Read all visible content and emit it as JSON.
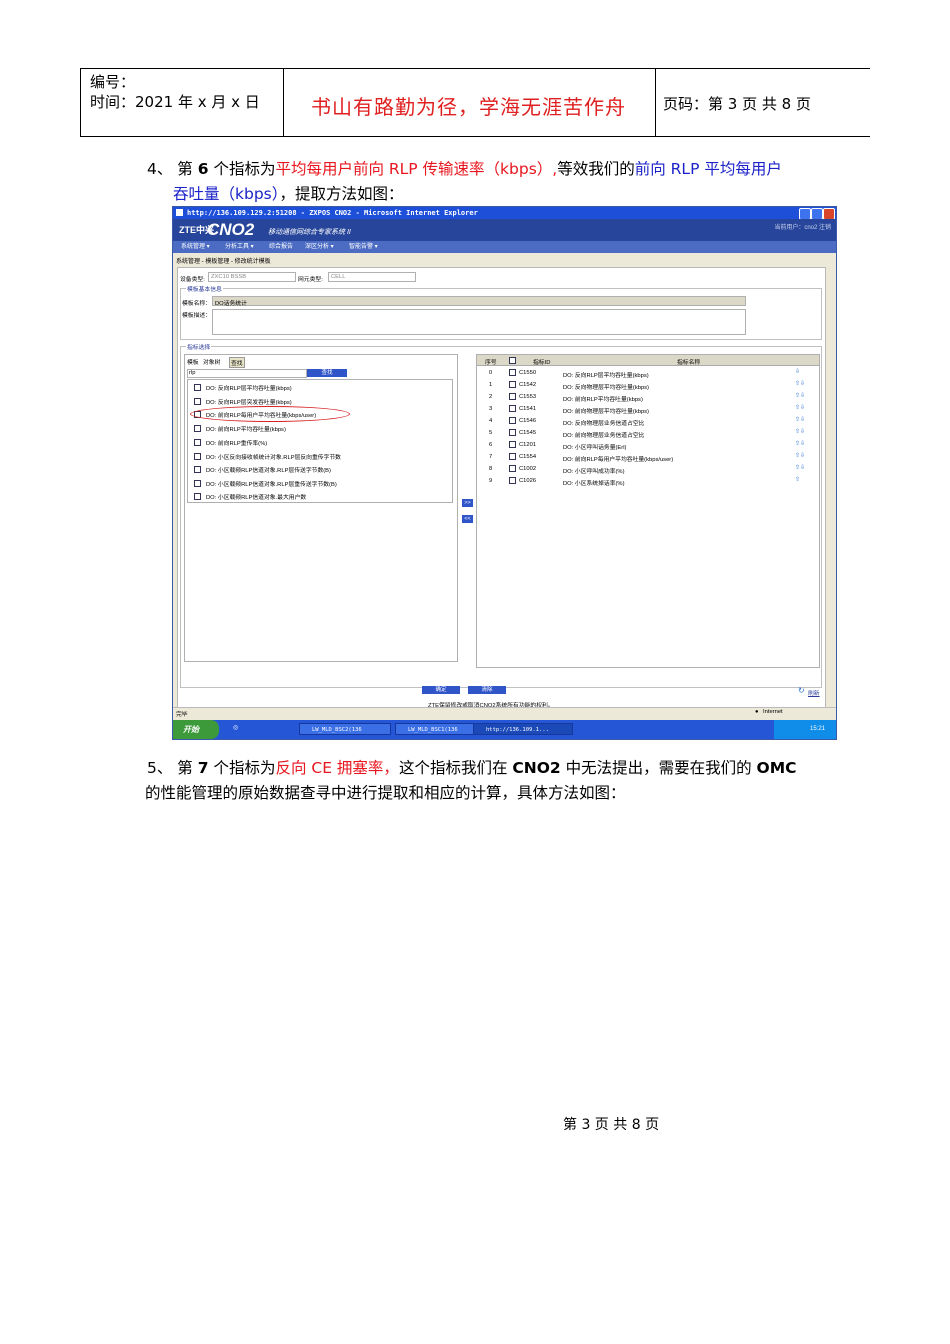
{
  "header": {
    "number_label": "编号：",
    "time_label": "时间：2021 年 x 月 x 日",
    "motto": "书山有路勤为径，学海无涯苦作舟",
    "page_label": "页码：第 3 页 共 8 页"
  },
  "para4": {
    "prefix": "4、 第 ",
    "num": "6",
    "mid": " 个指标为",
    "metric_red": "平均每用户前向 RLP 传输速率（kbps）,",
    "mid2": "等效我们的",
    "metric_blue_1": "前向 RLP 平均每用户",
    "metric_blue_2": "吞吐量（kbps）",
    "suffix": "，提取方法如图："
  },
  "screenshot": {
    "window_title": "http://136.109.129.2:51208 - ZXPOS CNO2 - Microsoft Internet Explorer",
    "logo": "ZTE中兴",
    "app_name": "CNO2",
    "app_subtitle": "移动通信网综合专家系统 II",
    "user_info": "当前用户：cno2  注销",
    "menu": [
      "系统管理 ▾",
      "分析工具 ▾",
      "综合报告",
      "深区分析 ▾",
      "智能告警 ▾"
    ],
    "breadcrumb": "系统管理 - 模板管理 - 修改统计模板",
    "device_type_label": "设备类型:",
    "device_type_value": "ZXC10 BSSB",
    "ne_type_label": "网元类型:",
    "ne_type_value": "CELL",
    "basic_info_legend": "模板基本信息",
    "template_name_label": "模板名称：",
    "template_name_value": "DO话务统计",
    "template_desc_label": "模板描述：",
    "indicator_legend": "指标选择",
    "tabs": [
      "模板",
      "对象树",
      "查找"
    ],
    "search_value": "rlp",
    "search_button": "查找",
    "left_items": [
      "DO: 反向RLP层平均吞吐量(kbps)",
      "DO: 反向RLP层突发吞吐量(kbps)",
      "DO: 前向RLP每用户平均吞吐量(kbps/user)",
      "DO: 前向RLP平均吞吐量(kbps)",
      "DO: 前向RLP重传率(%)",
      "DO: 小区反向接收帧统计对象.RLP层反向重传字节数",
      "DO: 小区载频RLP信道对象.RLP层传送字节数(B)",
      "DO: 小区载频RLP信道对象.RLP层重传送字节数(B)",
      "DO: 小区载频RLP信道对象.最大用户数"
    ],
    "add_button": ">>",
    "remove_button": "<<",
    "right_headers": [
      "序号",
      "指标ID",
      "指标名称"
    ],
    "right_rows": [
      {
        "seq": "0",
        "id": "C1550",
        "name": "DO: 反向RLP层平均吞吐量(kbps)"
      },
      {
        "seq": "1",
        "id": "C1542",
        "name": "DO: 反向物理层平均吞吐量(kbps)"
      },
      {
        "seq": "2",
        "id": "C1553",
        "name": "DO: 前向RLP平均吞吐量(kbps)"
      },
      {
        "seq": "3",
        "id": "C1541",
        "name": "DO: 前向物理层平均吞吐量(kbps)"
      },
      {
        "seq": "4",
        "id": "C1546",
        "name": "DO: 反向物理层业务信道占空比"
      },
      {
        "seq": "5",
        "id": "C1545",
        "name": "DO: 前向物理层业务信道占空比"
      },
      {
        "seq": "6",
        "id": "C1201",
        "name": "DO: 小区呼叫话务量(Erl)"
      },
      {
        "seq": "7",
        "id": "C1554",
        "name": "DO: 前向RLP每用户平均吞吐量(kbps/user)"
      },
      {
        "seq": "8",
        "id": "C1002",
        "name": "DO: 小区呼叫成功率(%)"
      },
      {
        "seq": "9",
        "id": "C1026",
        "name": "DO: 小区系统掉话率(%)"
      }
    ],
    "confirm_button": "确定",
    "clear_button": "清除",
    "refresh_label": "刷新",
    "copyright": "ZTE保留修改或取消CNO2系统所有功能的权利。",
    "status_left": "完毕",
    "status_right": "Internet",
    "start_button": "开始",
    "tasks": [
      "LW_MLD_BSC2(136",
      "LW_MLD_BSC1(136",
      "http://136.109.1..."
    ],
    "clock": "15:21"
  },
  "para5": {
    "prefix": "5、 第 ",
    "num": "7",
    "mid": " 个指标为",
    "metric_red": "反向 CE 拥塞率，",
    "mid2": "这个指标我们在 ",
    "cno2": "CNO2",
    "mid3": " 中无法提出，需要在我们的 ",
    "omc": "OMC",
    "line2": "的性能管理的原始数据查寻中进行提取和相应的计算，具体方法如图："
  },
  "footer": "第 3 页 共 8 页"
}
